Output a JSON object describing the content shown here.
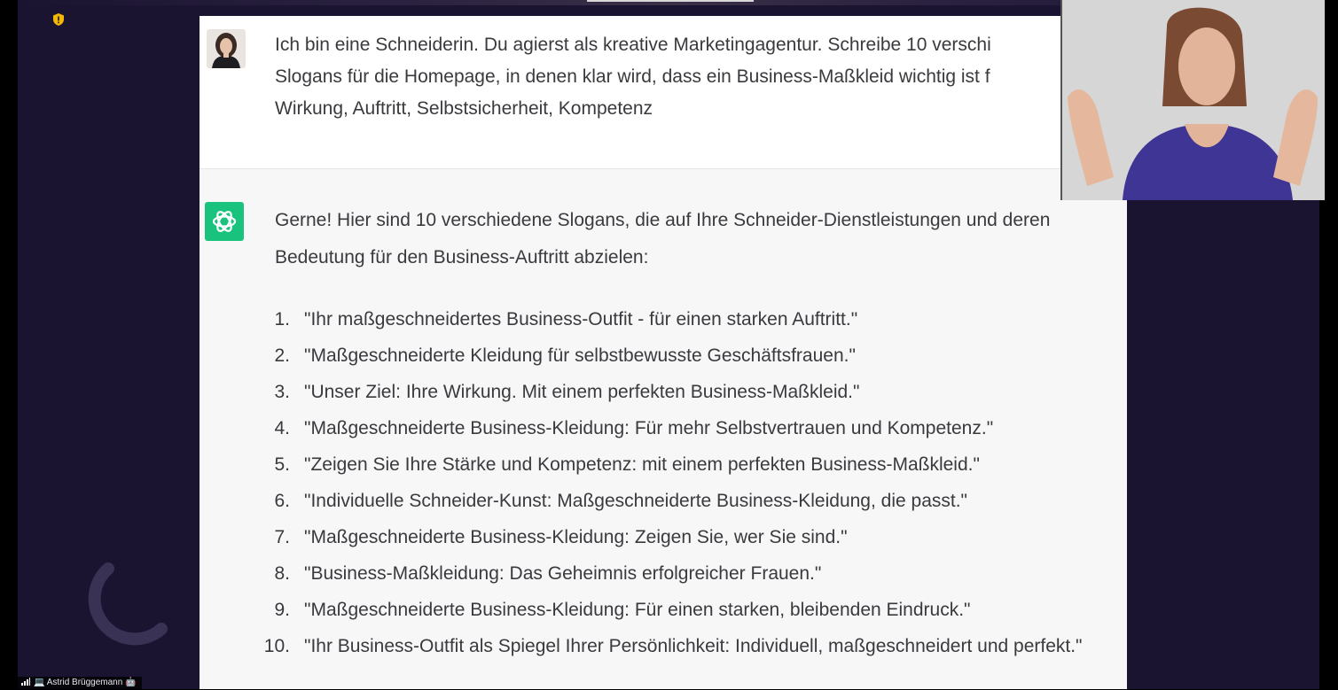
{
  "meeting": {
    "participant_name": "Astrid Brüggemann",
    "name_prefix_icon": "laptop-icon",
    "name_suffix_icon": "robot-icon"
  },
  "chat": {
    "user_message": "Ich bin eine Schneiderin. Du agierst als kreative Marketingagentur. Schreibe 10 verschi\nSlogans für die Homepage, in denen klar wird, dass ein Business-Maßkleid wichtig ist f\nWirkung, Auftritt, Selbstsicherheit, Kompetenz",
    "assistant_intro": "Gerne! Hier sind 10 verschiedene Slogans, die auf Ihre Schneider-Dienstleistungen und deren Bedeutung für den Business-Auftritt abzielen:",
    "slogans": [
      {
        "num": "1.",
        "text": "\"Ihr maßgeschneidertes Business-Outfit - für einen starken Auftritt.\""
      },
      {
        "num": "2.",
        "text": "\"Maßgeschneiderte Kleidung für selbstbewusste Geschäftsfrauen.\""
      },
      {
        "num": "3.",
        "text": "\"Unser Ziel: Ihre Wirkung. Mit einem perfekten Business-Maßkleid.\""
      },
      {
        "num": "4.",
        "text": "\"Maßgeschneiderte Business-Kleidung: Für mehr Selbstvertrauen und Kompetenz.\""
      },
      {
        "num": "5.",
        "text": "\"Zeigen Sie Ihre Stärke und Kompetenz: mit einem perfekten Business-Maßkleid.\""
      },
      {
        "num": "6.",
        "text": "\"Individuelle Schneider-Kunst: Maßgeschneiderte Business-Kleidung, die passt.\""
      },
      {
        "num": "7.",
        "text": "\"Maßgeschneiderte Business-Kleidung: Zeigen Sie, wer Sie sind.\""
      },
      {
        "num": "8.",
        "text": "\"Business-Maßkleidung: Das Geheimnis erfolgreicher Frauen.\""
      },
      {
        "num": "9.",
        "text": "\"Maßgeschneiderte Business-Kleidung: Für einen starken, bleibenden Eindruck.\""
      },
      {
        "num": "10.",
        "text": "\"Ihr Business-Outfit als Spiegel Ihrer Persönlichkeit: Individuell, maßgeschneidert und perfekt.\""
      }
    ]
  },
  "colors": {
    "stage_background": "#1b1431",
    "assistant_brand": "#19c37d",
    "shield_badge": "#f5b800"
  }
}
